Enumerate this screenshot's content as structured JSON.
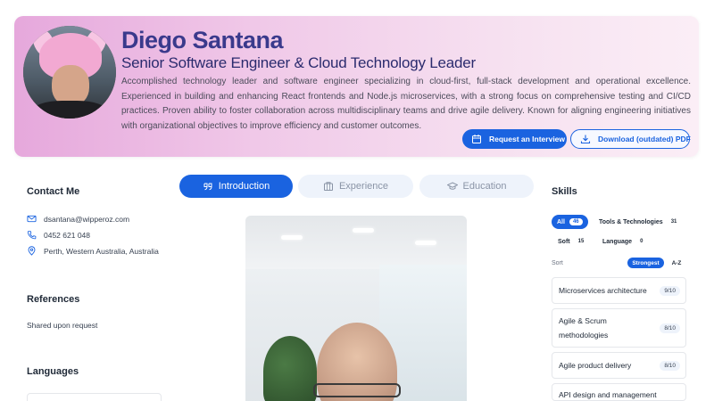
{
  "profile": {
    "name": "Diego Santana",
    "title": "Senior Software Engineer & Cloud Technology Leader",
    "summary": "Accomplished technology leader and software engineer specializing in cloud-first, full-stack development and operational excellence. Experienced in building and enhancing React frontends and Node.js microservices, with a strong focus on comprehensive testing and CI/CD practices. Proven ability to foster collaboration across multidisciplinary teams and drive agile delivery. Known for aligning engineering initiatives with organizational objectives to improve efficiency and customer outcomes."
  },
  "actions": {
    "request_interview": "Request an Interview",
    "download_pdf": "Download (outdated) PDF"
  },
  "contact": {
    "heading": "Contact Me",
    "email": "dsantana@wipperoz.com",
    "phone": "0452 621 048",
    "location": "Perth, Western Australia, Australia"
  },
  "references": {
    "heading": "References",
    "text": "Shared upon request"
  },
  "languages": {
    "heading": "Languages"
  },
  "tabs": [
    {
      "label": "Introduction",
      "icon": "quote-icon",
      "active": true
    },
    {
      "label": "Experience",
      "icon": "building-icon",
      "active": false
    },
    {
      "label": "Education",
      "icon": "graduation-cap-icon",
      "active": false
    }
  ],
  "skills": {
    "heading": "Skills",
    "filters": [
      {
        "label": "All",
        "count": "46",
        "active": true
      },
      {
        "label": "Tools & Technologies",
        "count": "31",
        "active": false
      },
      {
        "label": "Soft",
        "count": "15",
        "active": false
      },
      {
        "label": "Language",
        "count": "0",
        "active": false
      }
    ],
    "sort_label": "Sort",
    "sort_options": [
      "Strongest",
      "A-Z"
    ],
    "sort_selected": "Strongest",
    "items": [
      {
        "name": "Microservices architecture",
        "score": "9/10"
      },
      {
        "name": "Agile & Scrum methodologies",
        "score": "8/10"
      },
      {
        "name": "Agile product delivery",
        "score": "8/10"
      },
      {
        "name": "API design and management",
        "score": ""
      }
    ]
  },
  "colors": {
    "accent": "#1a63e0",
    "name": "#3a3a8c",
    "header_gradient_start": "#e6a8dc",
    "header_gradient_end": "#fbeef6"
  }
}
